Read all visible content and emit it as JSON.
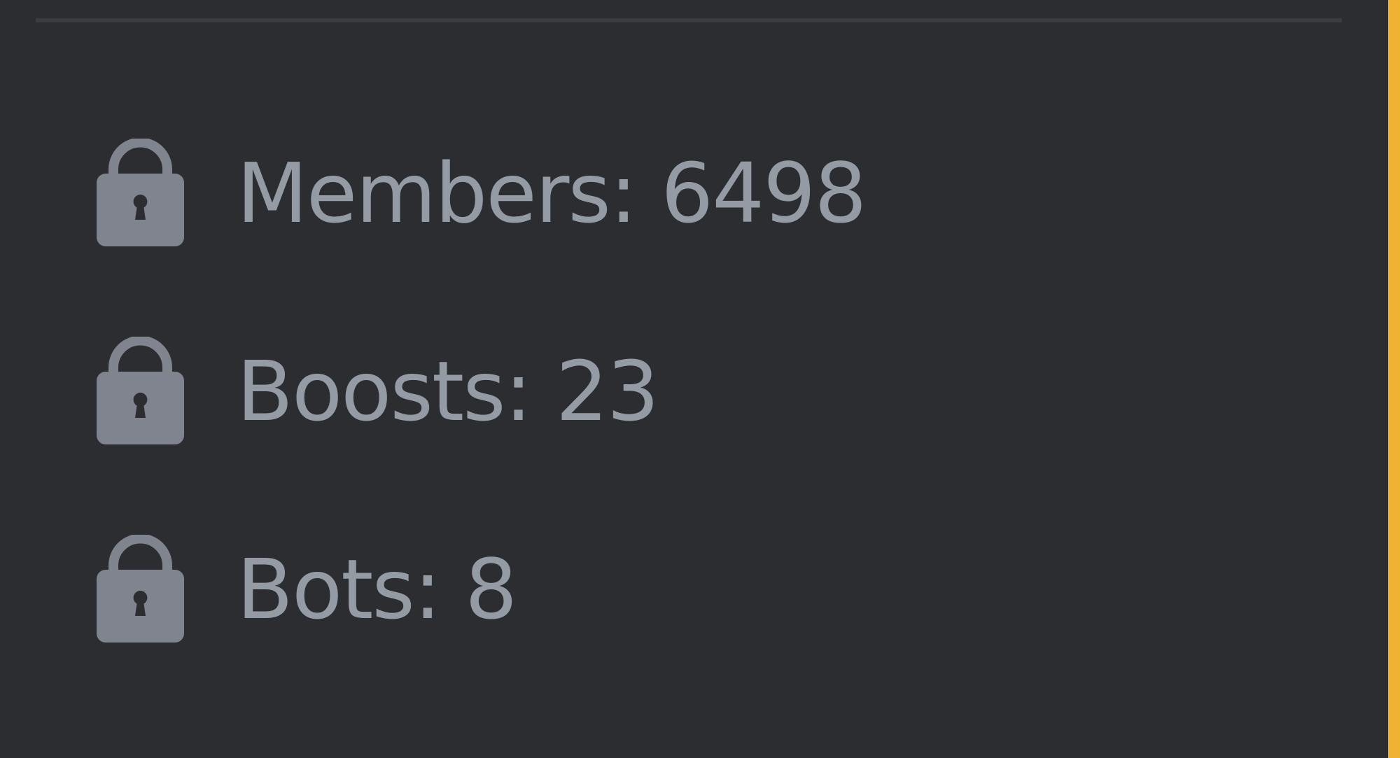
{
  "colors": {
    "background": "#2b2d31",
    "divider": "#3a3c42",
    "text": "#949ba4",
    "icon": "#80848e",
    "accent": "#f0b232"
  },
  "stats": [
    {
      "icon": "lock-icon",
      "label": "Members: 6498"
    },
    {
      "icon": "lock-icon",
      "label": "Boosts: 23"
    },
    {
      "icon": "lock-icon",
      "label": "Bots: 8"
    }
  ]
}
